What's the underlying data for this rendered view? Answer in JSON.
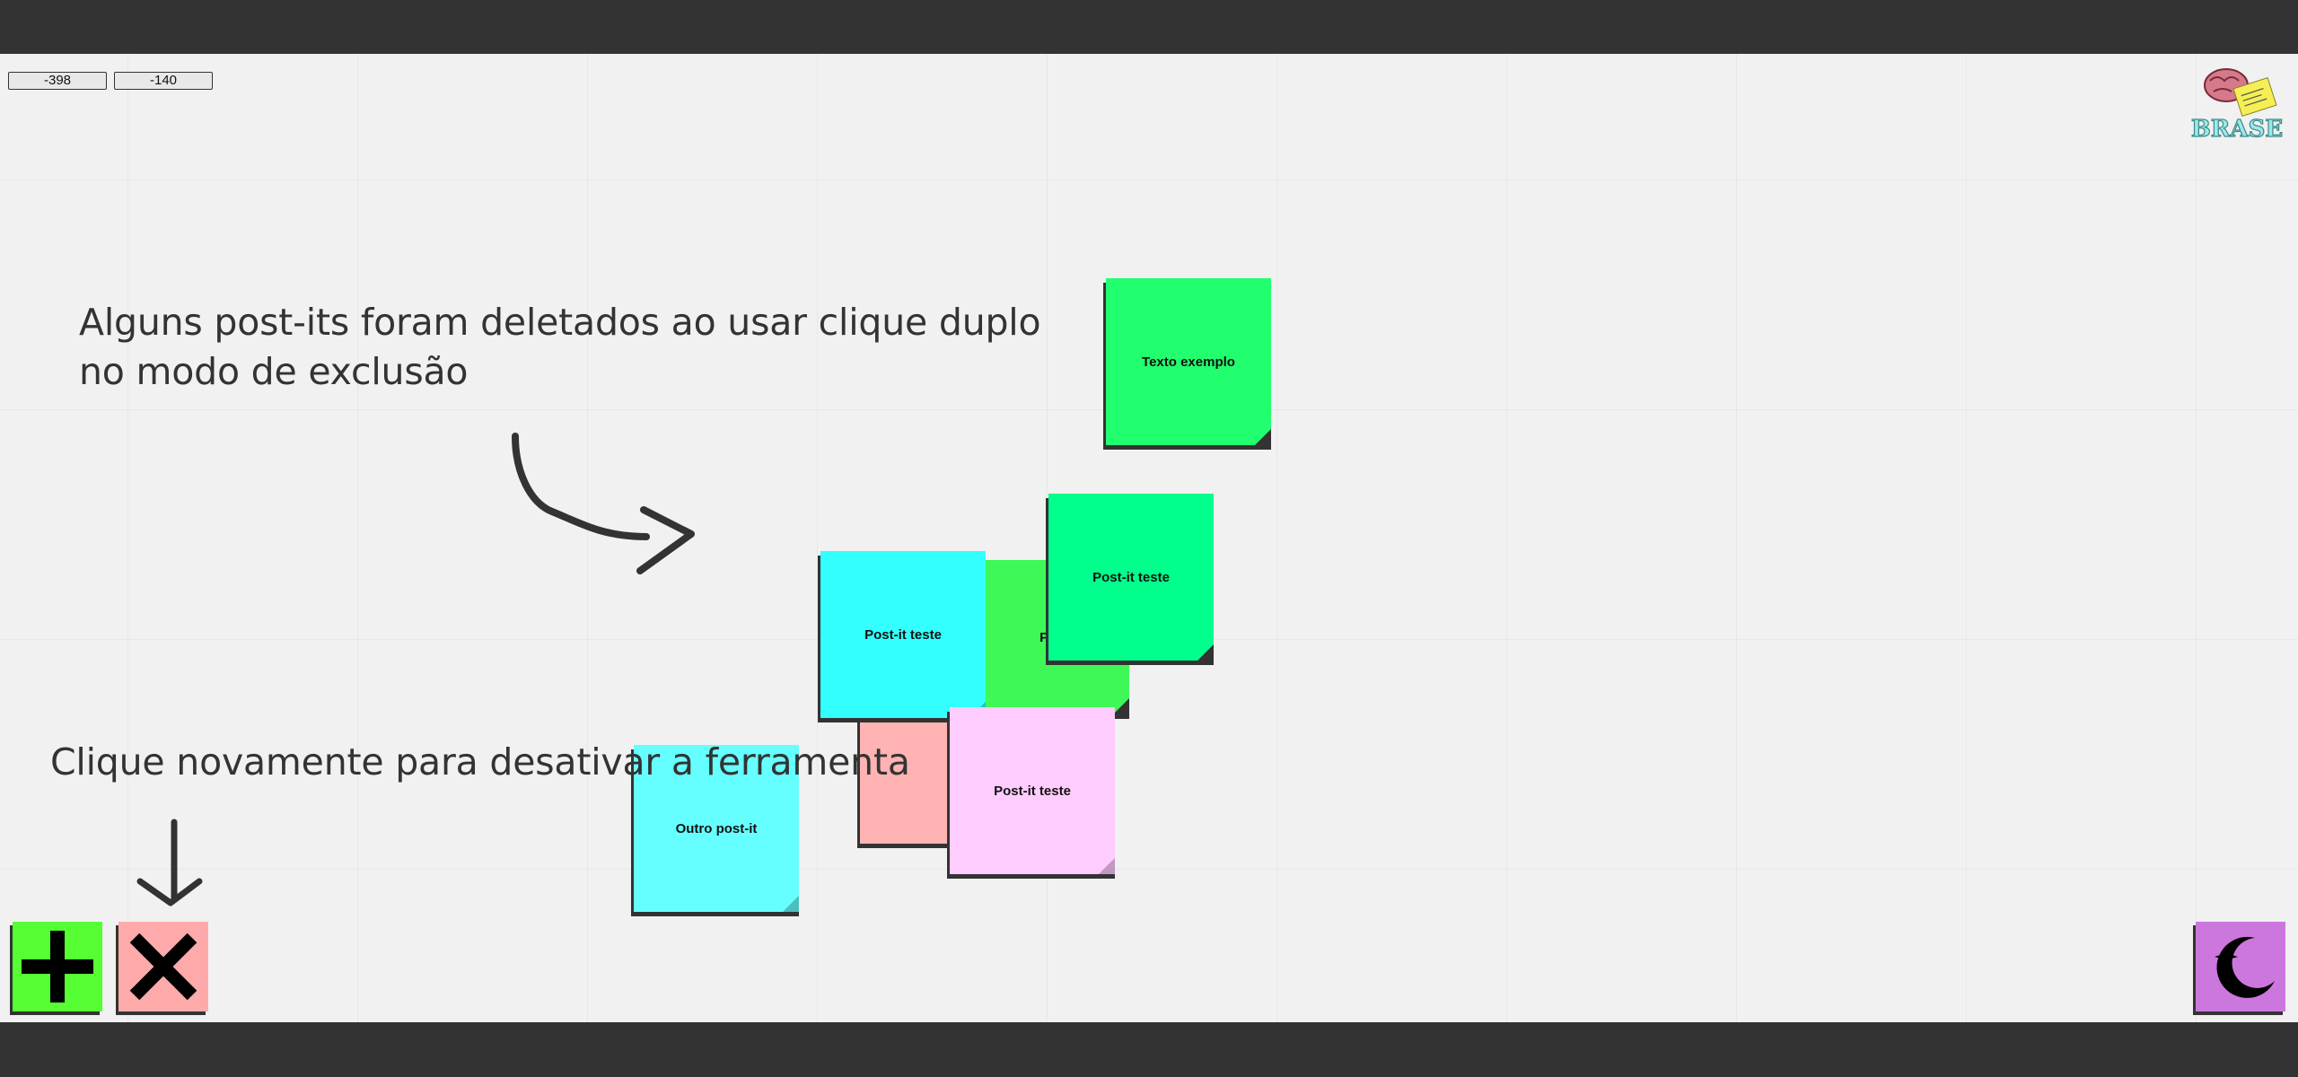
{
  "canvas": {
    "coord_x": "-398",
    "coord_y": "-140"
  },
  "logo": {
    "label": "BRASE",
    "sticky_text": "Kit 3 the Brainstorming"
  },
  "hints": {
    "delete_hint": "Alguns post-its foram deletados ao usar clique duplo no modo de exclusão",
    "deactivate_hint": "Clique novamente para desativar a ferramenta"
  },
  "notes": [
    {
      "text": "Texto exemplo",
      "color": "#22ff6e"
    },
    {
      "text": "",
      "color": "#ffb3b3"
    },
    {
      "text": "Post-it teste",
      "color": "#3ef858"
    },
    {
      "text": "Post-it teste",
      "color": "#00ff8c"
    },
    {
      "text": "Post-it teste",
      "color": "#33ffff"
    },
    {
      "text": "Post-it teste",
      "color": "#ffccff"
    },
    {
      "text": "Outro post-it",
      "color": "#66ffff"
    }
  ],
  "toolbar": {
    "add_icon": "plus-icon",
    "delete_icon": "close-icon",
    "theme_icon": "moon-icon",
    "add_color": "#55ff33",
    "delete_color": "#ffaaaa",
    "theme_color": "#cc77dd"
  }
}
